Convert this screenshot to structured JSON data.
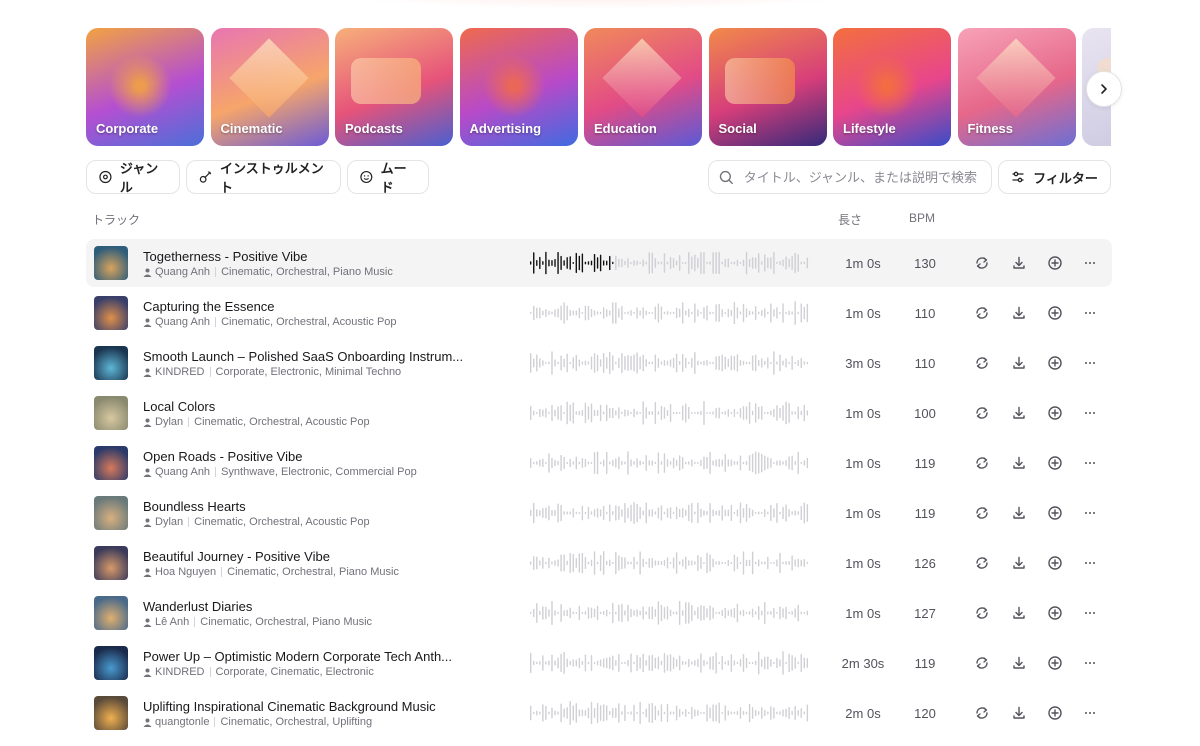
{
  "categories": [
    {
      "label": "Corporate",
      "c1": "#f2a341",
      "c2": "#b54fd1",
      "c3": "#4b6fd8"
    },
    {
      "label": "Cinematic",
      "c1": "#e875b2",
      "c2": "#f6a56a",
      "c3": "#6b5bd6"
    },
    {
      "label": "Podcasts",
      "c1": "#f7b07a",
      "c2": "#e6537a",
      "c3": "#4a5fd0"
    },
    {
      "label": "Advertising",
      "c1": "#ef6a4d",
      "c2": "#b84ac8",
      "c3": "#3f6be0"
    },
    {
      "label": "Education",
      "c1": "#f08a5a",
      "c2": "#e24b86",
      "c3": "#5a5ad6"
    },
    {
      "label": "Social",
      "c1": "#f28a4a",
      "c2": "#d63e7a",
      "c3": "#342a7a"
    },
    {
      "label": "Lifestyle",
      "c1": "#f36f3d",
      "c2": "#e8468b",
      "c3": "#3a4cc8"
    },
    {
      "label": "Fitness",
      "c1": "#f7a2b8",
      "c2": "#e6678a",
      "c3": "#6b6fd4"
    },
    {
      "label": "",
      "c1": "#e8e4f0",
      "c2": "#d8d4e8",
      "c3": "#c8c4dc"
    }
  ],
  "filters": {
    "genre": "ジャンル",
    "instrument": "インストゥルメント",
    "mood": "ムード",
    "search_placeholder": "タイトル、ジャンル、または説明で検索",
    "filter_button": "フィルター"
  },
  "table": {
    "col_track": "トラック",
    "col_length": "長さ",
    "col_bpm": "BPM"
  },
  "tracks": [
    {
      "title": "Togetherness - Positive Vibe",
      "artist": "Quang Anh",
      "tags": "Cinematic, Orchestral, Piano Music",
      "length": "1m 0s",
      "bpm": "130",
      "active": true,
      "progress": 0.3,
      "thumb": [
        "#2f5d7a",
        "#d9a35c"
      ]
    },
    {
      "title": "Capturing the Essence",
      "artist": "Quang Anh",
      "tags": "Cinematic, Orchestral, Acoustic Pop",
      "length": "1m 0s",
      "bpm": "110",
      "active": false,
      "progress": 0,
      "thumb": [
        "#3a3f6a",
        "#e0904a"
      ]
    },
    {
      "title": "Smooth Launch – Polished SaaS Onboarding Instrum...",
      "artist": "KINDRED",
      "tags": "Corporate, Electronic, Minimal Techno",
      "length": "3m 0s",
      "bpm": "110",
      "active": false,
      "progress": 0,
      "thumb": [
        "#1a3550",
        "#5fb7d6"
      ]
    },
    {
      "title": "Local Colors",
      "artist": "Dylan",
      "tags": "Cinematic, Orchestral, Acoustic Pop",
      "length": "1m 0s",
      "bpm": "100",
      "active": false,
      "progress": 0,
      "thumb": [
        "#8a8a70",
        "#d8c8a0"
      ]
    },
    {
      "title": "Open Roads - Positive Vibe",
      "artist": "Quang Anh",
      "tags": "Synthwave, Electronic, Commercial Pop",
      "length": "1m 0s",
      "bpm": "119",
      "active": false,
      "progress": 0,
      "thumb": [
        "#2b3a6a",
        "#d87a5a"
      ]
    },
    {
      "title": "Boundless Hearts",
      "artist": "Dylan",
      "tags": "Cinematic, Orchestral, Acoustic Pop",
      "length": "1m 0s",
      "bpm": "119",
      "active": false,
      "progress": 0,
      "thumb": [
        "#6a7a7a",
        "#d8b080"
      ]
    },
    {
      "title": "Beautiful Journey - Positive Vibe",
      "artist": "Hoa Nguyen",
      "tags": "Cinematic, Orchestral, Piano Music",
      "length": "1m 0s",
      "bpm": "126",
      "active": false,
      "progress": 0,
      "thumb": [
        "#3a3a5a",
        "#d89a6a"
      ]
    },
    {
      "title": "Wanderlust Diaries",
      "artist": "Lê Anh",
      "tags": "Cinematic, Orchestral, Piano Music",
      "length": "1m 0s",
      "bpm": "127",
      "active": false,
      "progress": 0,
      "thumb": [
        "#4a6a8a",
        "#e0b070"
      ]
    },
    {
      "title": "Power Up – Optimistic Modern Corporate Tech Anth...",
      "artist": "KINDRED",
      "tags": "Corporate, Cinematic, Electronic",
      "length": "2m 30s",
      "bpm": "119",
      "active": false,
      "progress": 0,
      "thumb": [
        "#1a2a4a",
        "#4a9ad0"
      ]
    },
    {
      "title": "Uplifting Inspirational Cinematic Background Music",
      "artist": "quangtonle",
      "tags": "Cinematic, Orchestral, Uplifting",
      "length": "2m 0s",
      "bpm": "120",
      "active": false,
      "progress": 0,
      "thumb": [
        "#5a4a3a",
        "#f0b050"
      ]
    }
  ],
  "icons": {
    "carousel_next": "chevron-right-icon",
    "genre": "genre-disc-icon",
    "instrument": "guitar-icon",
    "mood": "smiley-icon",
    "search": "search-icon",
    "filter": "sliders-icon",
    "artist": "person-icon",
    "row_actions": [
      "loop-icon",
      "download-icon",
      "add-circle-icon",
      "more-icon"
    ]
  },
  "colors": {
    "waveform_played": "#111111",
    "waveform_unplayed": "#cfcfd4",
    "active_row": "#f4f4f5"
  }
}
